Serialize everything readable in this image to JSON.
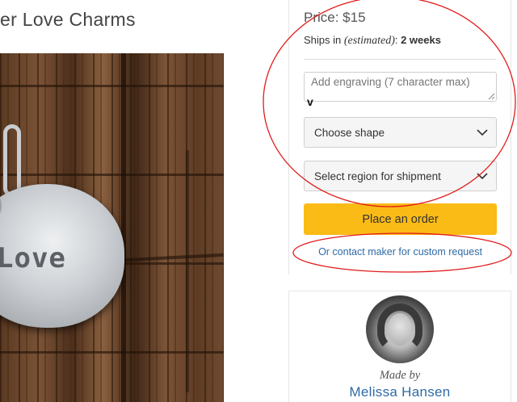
{
  "product": {
    "title": "er Love Charms"
  },
  "image": {
    "charm_text": "Love"
  },
  "purchase": {
    "price": "Price: $15",
    "ships_prefix": "Ships in ",
    "ships_estimated": "(estimated)",
    "ships_colon": ": ",
    "ships_weeks": "2 weeks",
    "engraving_placeholder": "Add engraving (7 character max)",
    "cursor_glyph": "v",
    "shape_select_label": "Choose shape",
    "region_select_label": "Select region for shipment",
    "order_button_label": "Place an order",
    "contact_link_label": "Or contact maker for custom request"
  },
  "maker": {
    "made_by_label": "Made by",
    "name": "Melissa Hansen"
  },
  "colors": {
    "accent_button": "#fbbb16",
    "link": "#2e6aa6",
    "annotation": "#e21b1b"
  },
  "icons": [
    "chevron-down-icon",
    "resize-grip-icon"
  ]
}
